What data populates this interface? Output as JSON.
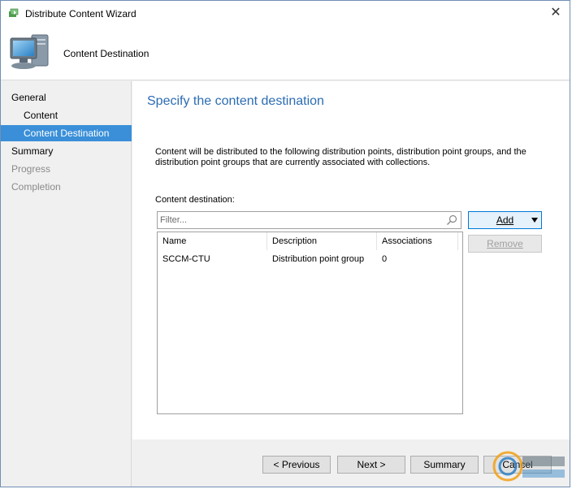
{
  "window": {
    "title": "Distribute Content Wizard",
    "close_glyph": "✕"
  },
  "banner": {
    "heading": "Content Destination",
    "icon": "computer-icon"
  },
  "sidebar": {
    "items": [
      {
        "label": "General",
        "state": "normal",
        "indent": 0
      },
      {
        "label": "Content",
        "state": "normal",
        "indent": 1
      },
      {
        "label": "Content Destination",
        "state": "selected",
        "indent": 1
      },
      {
        "label": "Summary",
        "state": "normal",
        "indent": 0
      },
      {
        "label": "Progress",
        "state": "disabled",
        "indent": 0
      },
      {
        "label": "Completion",
        "state": "disabled",
        "indent": 0
      }
    ]
  },
  "main": {
    "title": "Specify the content destination",
    "description": "Content will be distributed to the following distribution points, distribution point groups, and the distribution point groups that are currently associated with collections.",
    "destination_label": "Content destination:",
    "filter_placeholder": "Filter...",
    "columns": [
      "Name",
      "Description",
      "Associations"
    ],
    "rows": [
      [
        "SCCM-CTU",
        "Distribution point group",
        "0"
      ]
    ],
    "add_button": "Add",
    "remove_button": "Remove"
  },
  "footer": {
    "previous": "< Previous",
    "next": "Next >",
    "summary": "Summary",
    "cancel": "Cancel"
  },
  "colors": {
    "accent": "#3a8fd8",
    "title_blue": "#2b6cb3"
  }
}
